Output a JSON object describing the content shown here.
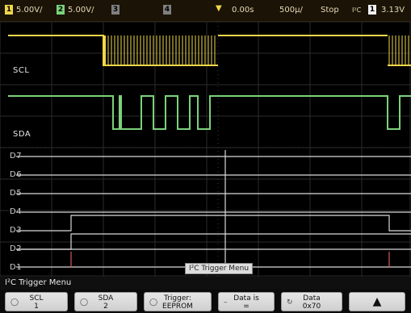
{
  "status": {
    "ch1_scale": "5.00V/",
    "ch2_scale": "5.00V/",
    "ch3_label": "3",
    "ch4_label": "4",
    "time_position": "0.00s",
    "time_scale": "500µ/",
    "run_state": "Stop",
    "trigger_type": "I²C",
    "trigger_source": "1",
    "trigger_level": "3.13V"
  },
  "channels": {
    "scl_label": "SCL",
    "sda_label": "SDA",
    "digital": [
      "D7",
      "D6",
      "D5",
      "D4",
      "D3",
      "D2",
      "D1",
      "D0"
    ]
  },
  "popup": "I²C Trigger Menu",
  "menu": {
    "title": "I²C Trigger Menu",
    "softkeys": [
      {
        "top": "SCL",
        "bottom": "1"
      },
      {
        "top": "SDA",
        "bottom": "2"
      },
      {
        "top": "Trigger:",
        "bottom": "EEPROM"
      },
      {
        "top": "Data is",
        "bottom": "="
      },
      {
        "top": "Data",
        "bottom": "0x70"
      }
    ]
  },
  "colors": {
    "ch1": "#f1d74a",
    "ch2": "#7bd27b",
    "digital": "#d9d9d9",
    "grid": "#2a2a2a"
  }
}
